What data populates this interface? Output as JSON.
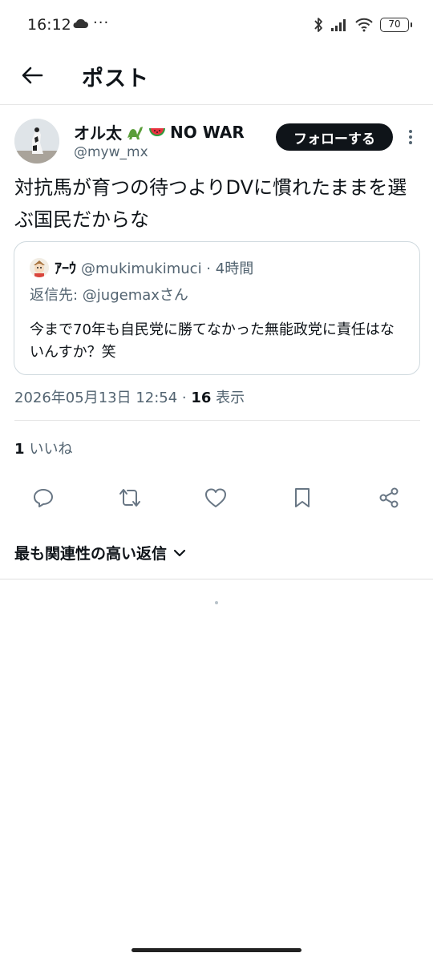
{
  "status_bar": {
    "time": "16:12",
    "extra": "···",
    "battery": "70"
  },
  "header": {
    "title": "ポスト"
  },
  "post": {
    "author_name": "オル太",
    "author_name_suffix": "NO WAR",
    "author_handle": "@myw_mx",
    "follow_label": "フォローする",
    "text": "対抗馬が育つの待つよりDVに慣れたままを選ぶ国民だからな",
    "timestamp": "2026年05月13日 12:54 · ",
    "views_count": "16",
    "views_label": " 表示",
    "likes_count": "1",
    "likes_label": "いいね"
  },
  "quote": {
    "author_name": "ｱｰｳ",
    "author_handle": "@mukimukimuci",
    "time": " · 4時間",
    "reply_to": "返信先: @jugemaxさん",
    "text": "今まで70年も自民党に勝てなかった無能政党に責任はないんすか？笑"
  },
  "replies": {
    "sort_label": "最も関連性の高い返信"
  },
  "icons": {
    "back": "arrow-left-icon",
    "reply": "comment-icon",
    "repost": "repost-icon",
    "like": "heart-icon",
    "bookmark": "bookmark-icon",
    "share": "share-icon",
    "sort": "chevron-down-icon"
  },
  "colors": {
    "text_primary": "#0f1419",
    "text_secondary": "#536471",
    "border": "#cfd9de",
    "follow_bg": "#0f1419"
  }
}
